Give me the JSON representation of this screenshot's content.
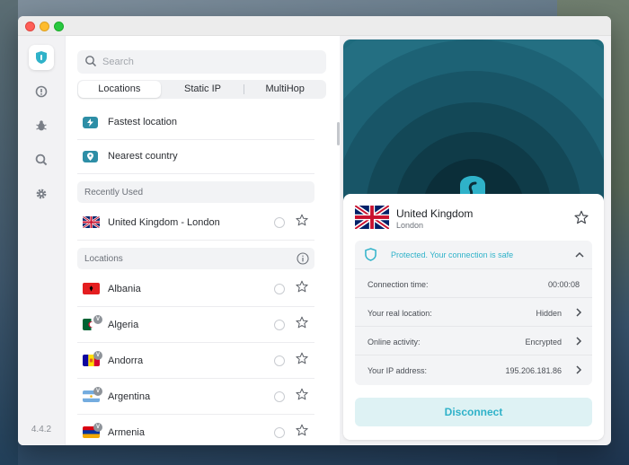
{
  "app": {
    "version": "4.4.2"
  },
  "search": {
    "placeholder": "Search"
  },
  "tabs": [
    {
      "label": "Locations",
      "active": true
    },
    {
      "label": "Static IP",
      "active": false
    },
    {
      "label": "MultiHop",
      "active": false
    }
  ],
  "quick_connect": [
    {
      "label": "Fastest location",
      "icon": "lightning-icon"
    },
    {
      "label": "Nearest country",
      "icon": "pin-icon"
    }
  ],
  "recently_used": {
    "header": "Recently Used",
    "items": [
      {
        "name": "United Kingdom - London",
        "flag": "uk-flag-icon"
      }
    ]
  },
  "locations": {
    "header": "Locations",
    "items": [
      {
        "name": "Albania",
        "flag": "albania-flag-icon",
        "virtual": false
      },
      {
        "name": "Algeria",
        "flag": "algeria-flag-icon",
        "virtual": true
      },
      {
        "name": "Andorra",
        "flag": "andorra-flag-icon",
        "virtual": true
      },
      {
        "name": "Argentina",
        "flag": "argentina-flag-icon",
        "virtual": true
      },
      {
        "name": "Armenia",
        "flag": "armenia-flag-icon",
        "virtual": true
      }
    ]
  },
  "connection": {
    "country": "United Kingdom",
    "city": "London",
    "status": "Protected. Your connection is safe",
    "details": [
      {
        "label": "Connection time:",
        "value": "00:00:08",
        "has_arrow": false
      },
      {
        "label": "Your real location:",
        "value": "Hidden",
        "has_arrow": true
      },
      {
        "label": "Online activity:",
        "value": "Encrypted",
        "has_arrow": true
      },
      {
        "label": "Your IP address:",
        "value": "195.206.181.86",
        "has_arrow": true
      }
    ],
    "disconnect_label": "Disconnect"
  },
  "colors": {
    "accent": "#2fb2c9",
    "brand_teal": "#1f6c7e",
    "disconnect_bg": "#def2f4"
  }
}
